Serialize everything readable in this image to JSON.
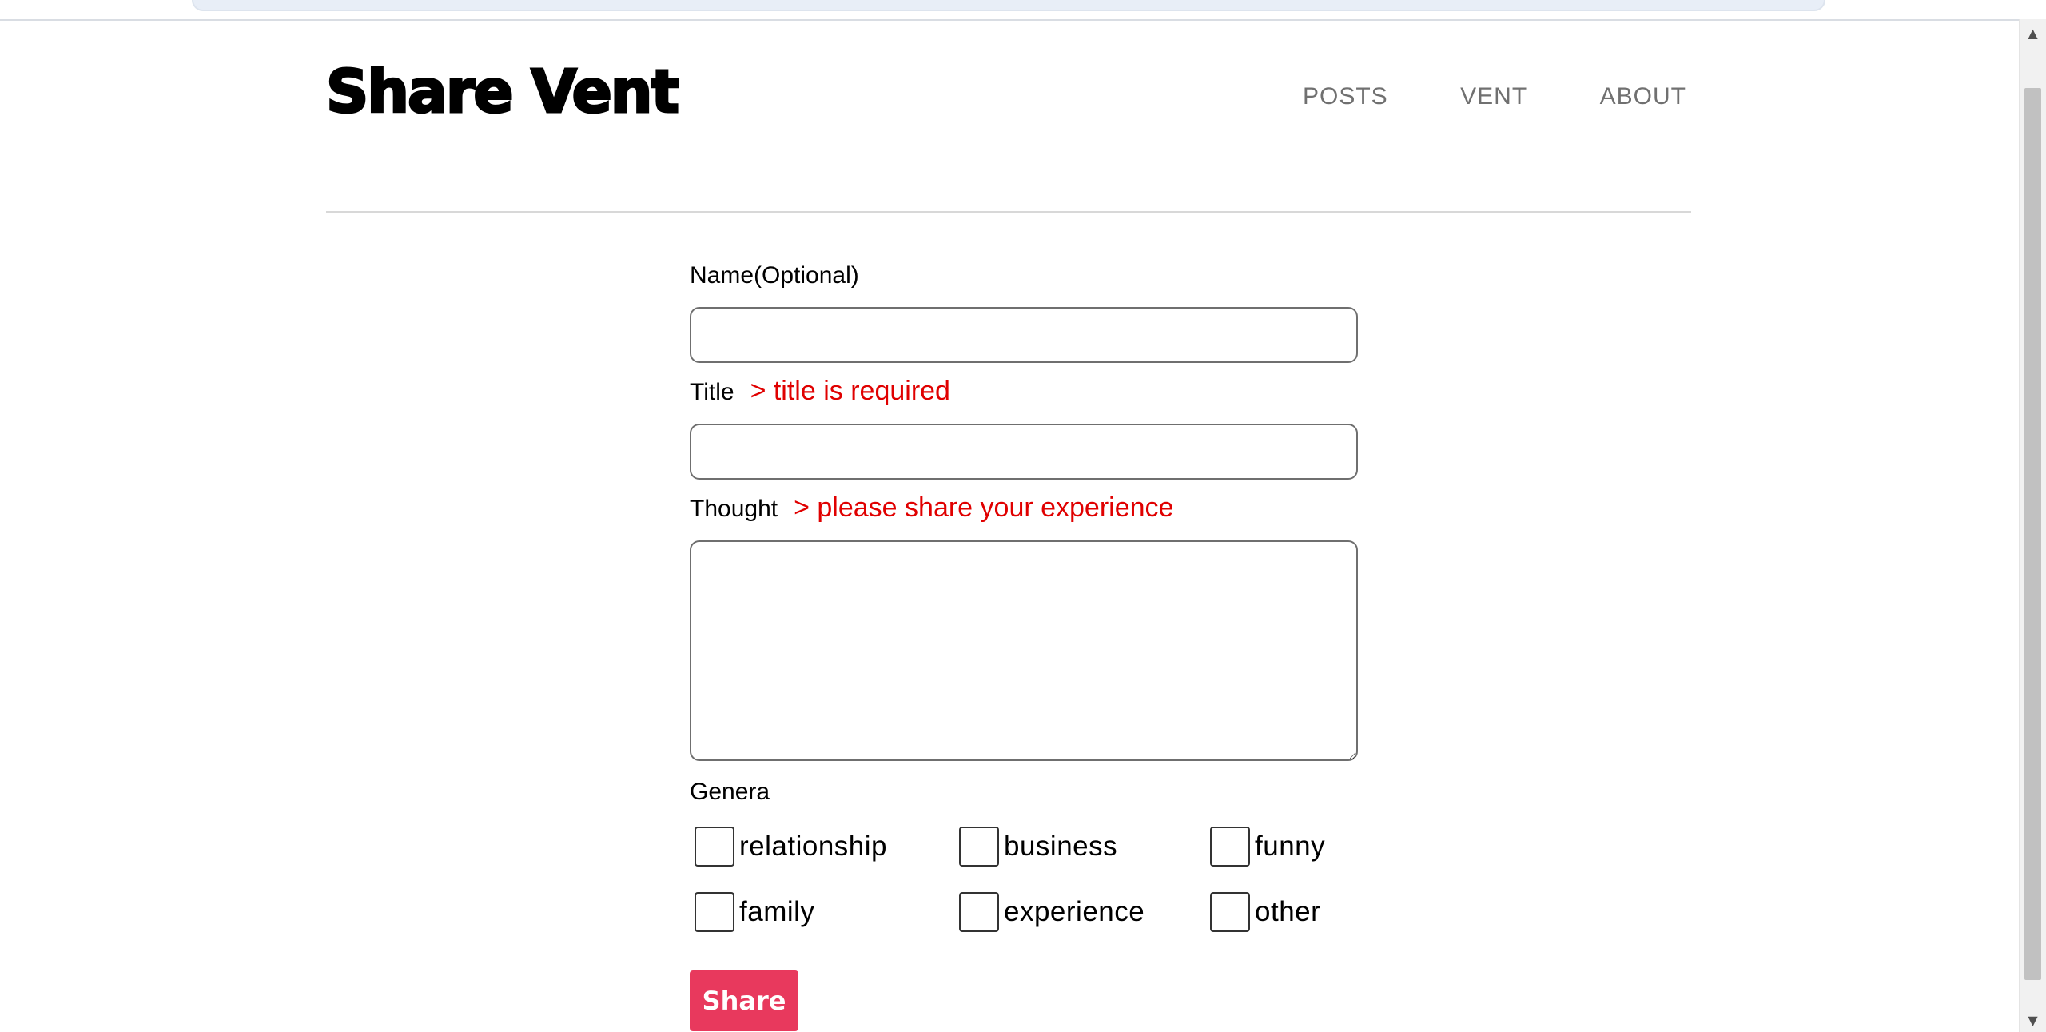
{
  "header": {
    "brand": "Share Vent",
    "nav": [
      "POSTS",
      "VENT",
      "ABOUT"
    ]
  },
  "form": {
    "name_label": "Name(Optional)",
    "name_value": "",
    "title_label": "Title",
    "title_error": "> title is required",
    "title_value": "",
    "thought_label": "Thought",
    "thought_error": "> please share your experience",
    "thought_value": "",
    "genera_label": "Genera",
    "genres": [
      {
        "label": "relationship",
        "checked": false
      },
      {
        "label": "business",
        "checked": false
      },
      {
        "label": "funny",
        "checked": false
      },
      {
        "label": "family",
        "checked": false
      },
      {
        "label": "experience",
        "checked": false
      },
      {
        "label": "other",
        "checked": false
      }
    ],
    "submit_label": "Share"
  },
  "colors": {
    "error": "#e00000",
    "button": "#e8395d",
    "nav": "#707070"
  },
  "icons": {
    "scroll_up": "scroll-up-arrow-icon",
    "scroll_down": "scroll-down-arrow-icon"
  }
}
